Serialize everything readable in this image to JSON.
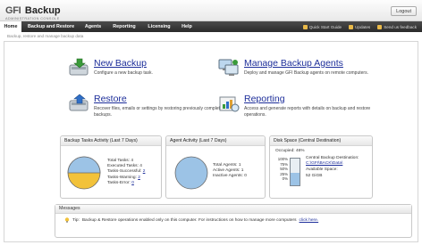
{
  "app": {
    "logo_gfi": "GFI",
    "logo_backup": "Backup",
    "logo_subtitle": "ADMINISTRATION CONSOLE",
    "logout": "Logout"
  },
  "nav": {
    "tabs": [
      "Home",
      "Backup and Restore",
      "Agents",
      "Reporting",
      "Licensing",
      "Help"
    ],
    "links": [
      "Quick Start Guide",
      "Updates",
      "Send us feedback"
    ]
  },
  "tagline": "Backup, restore and manage backup data",
  "actions": {
    "new_backup": {
      "title": "New Backup",
      "desc": "Configure a new backup task."
    },
    "manage_agents": {
      "title": "Manage Backup Agents",
      "desc": "Deploy and manage GFI Backup agents on remote computers."
    },
    "restore": {
      "title": "Restore",
      "desc": "Recover files, emails or settings by restoring previously completed backups."
    },
    "reporting": {
      "title": "Reporting",
      "desc": "Access and generate reports with details on backup and restore operations."
    }
  },
  "tasks_panel": {
    "title": "Backup Tasks Activity (Last 7 Days)",
    "total_label": "Total Tasks:",
    "total": "4",
    "executed_label": "Executed Tasks:",
    "executed": "4",
    "successful_label": "Tasks-Successful:",
    "successful": "2",
    "warning_label": "Tasks-Warning:",
    "warning": "2",
    "error_label": "Tasks-Error:",
    "error": "0",
    "pie_fraction_successful": 0.5,
    "color_successful": "#9cc3e6",
    "color_warning": "#f2c23a"
  },
  "agents_panel": {
    "title": "Agent Activity (Last 7 Days)",
    "total_label": "Total Agents:",
    "total": "1",
    "active_label": "Active Agents:",
    "active": "1",
    "inactive_label": "Inactive Agents:",
    "inactive": "0",
    "color_active": "#9cc3e6"
  },
  "disk_panel": {
    "title": "Disk Space (Central Destination)",
    "occupied_label": "Occupied:",
    "occupied": "46%",
    "occupied_fraction": 0.46,
    "scale": [
      "100%",
      "75%",
      "50%",
      "25%",
      "0%"
    ],
    "central_label": "Central Backup Destination:",
    "central_link": "C:\\GFI\\BACK\\Data\\",
    "available_label": "Available Space:",
    "available": "52 GiGB"
  },
  "messages": {
    "title": "Messages",
    "text": "Backup & Restore operations enabled only on this computer. For instructions on how to manage more computers",
    "prefix": "Tip:",
    "link": "click here."
  }
}
